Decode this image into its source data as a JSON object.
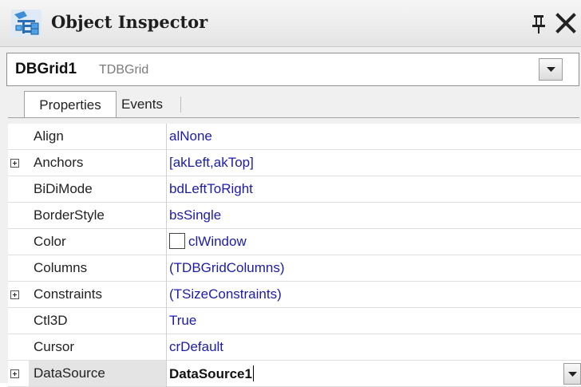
{
  "window": {
    "title": "Object Inspector",
    "pin_icon": "pin-icon",
    "close_icon": "close-icon"
  },
  "component_selector": {
    "name": "DBGrid1",
    "type": "TDBGrid"
  },
  "tabs": [
    {
      "label": "Properties",
      "active": true
    },
    {
      "label": "Events",
      "active": false
    }
  ],
  "properties": [
    {
      "name": "Align",
      "value": "alNone",
      "expandable": false
    },
    {
      "name": "Anchors",
      "value": "[akLeft,akTop]",
      "expandable": true
    },
    {
      "name": "BiDiMode",
      "value": "bdLeftToRight",
      "expandable": false
    },
    {
      "name": "BorderStyle",
      "value": "bsSingle",
      "expandable": false
    },
    {
      "name": "Color",
      "value": "clWindow",
      "expandable": false,
      "swatch_color": "#ffffff"
    },
    {
      "name": "Columns",
      "value": "(TDBGridColumns)",
      "expandable": false
    },
    {
      "name": "Constraints",
      "value": "(TSizeConstraints)",
      "expandable": true
    },
    {
      "name": "Ctl3D",
      "value": "True",
      "expandable": false
    },
    {
      "name": "Cursor",
      "value": "crDefault",
      "expandable": false
    },
    {
      "name": "DataSource",
      "value": "DataSource1",
      "expandable": true,
      "selected": true
    }
  ],
  "colors": {
    "value_text": "#1c1ca8",
    "title_bar": "#ececec",
    "selected_row": "#e4e4e4"
  }
}
